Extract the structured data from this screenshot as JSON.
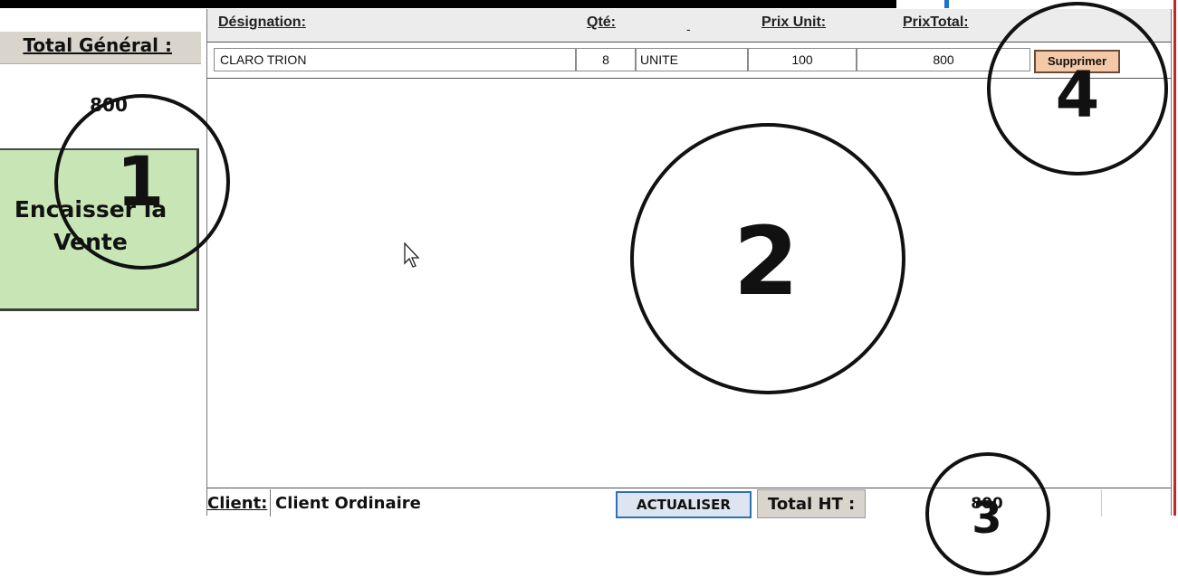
{
  "left_panel": {
    "total_label": "Total Général :",
    "total_value": "800",
    "encaisser_button": "Encaisser la\nVente"
  },
  "table": {
    "headers": {
      "designation": "Désignation:",
      "qte": "Qté:",
      "dash": "-",
      "prix_unit": "Prix Unit:",
      "prix_total": "PrixTotal:"
    },
    "rows": [
      {
        "designation": "CLARO TRION",
        "qte": "8",
        "unite": "UNITE",
        "prix_unit": "100",
        "prix_total": "800",
        "delete_label": "Supprimer"
      }
    ]
  },
  "footer": {
    "client_label": "Client:",
    "client_value": "Client Ordinaire",
    "refresh_button": "ACTUALISER",
    "total_ht_label": "Total HT :",
    "total_ht_value": "800"
  },
  "annotations": [
    "1",
    "2",
    "3",
    "4"
  ],
  "colors": {
    "pay_button_bg": "#c7e5b5",
    "delete_button_bg": "#f3c9a8",
    "refresh_button_border": "#2f6fb8",
    "label_box_bg": "#d9d5cc",
    "right_edge_red": "#c22222"
  }
}
